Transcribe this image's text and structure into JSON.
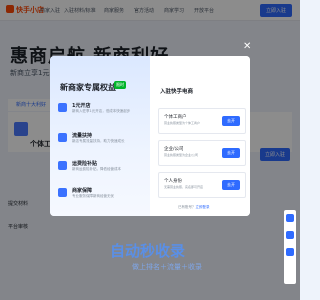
{
  "nav": {
    "logo": "快手小店",
    "items": [
      "商家入驻",
      "入驻材料/标准",
      "商家服务",
      "官方活动",
      "商家学习",
      "开放平台"
    ],
    "cta": "立即入驻"
  },
  "hero": {
    "title": "惠商启航 新商利好",
    "subtitle": "新商立享1元开店特权"
  },
  "page": {
    "tab": "新商十大利好",
    "card_title": "个体工商户",
    "right_button": "立即入驻",
    "side_items": [
      "提交材料",
      "平台审核"
    ]
  },
  "modal": {
    "left_title": "新商家专属权益",
    "badge": "限时",
    "benefits": [
      {
        "title": "1元开店",
        "desc": "新商入驻享1元开店，低成本快速起步"
      },
      {
        "title": "流量扶持",
        "desc": "新店专属流量扶持，助力快速成长"
      },
      {
        "title": "运费险补贴",
        "desc": "新商运费险补贴，降低经营成本"
      },
      {
        "title": "商家保障",
        "desc": "专业服务保障新商经营无忧"
      }
    ],
    "right_title": "入驻快手电商",
    "options": [
      {
        "title": "个体工商户",
        "desc": "营业执照类型为个体工商户",
        "button": "去开"
      },
      {
        "title": "企业/公司",
        "desc": "营业执照类型为企业/公司",
        "button": "去开"
      },
      {
        "title": "个人身份",
        "desc": "无需营业执照，实名即可开店",
        "button": "去开"
      }
    ],
    "footer_text": "已有账号？",
    "footer_link": "立即登录"
  },
  "watermark": {
    "main": "自动秒收录",
    "sub": "做上排名＋流量＋收录"
  }
}
